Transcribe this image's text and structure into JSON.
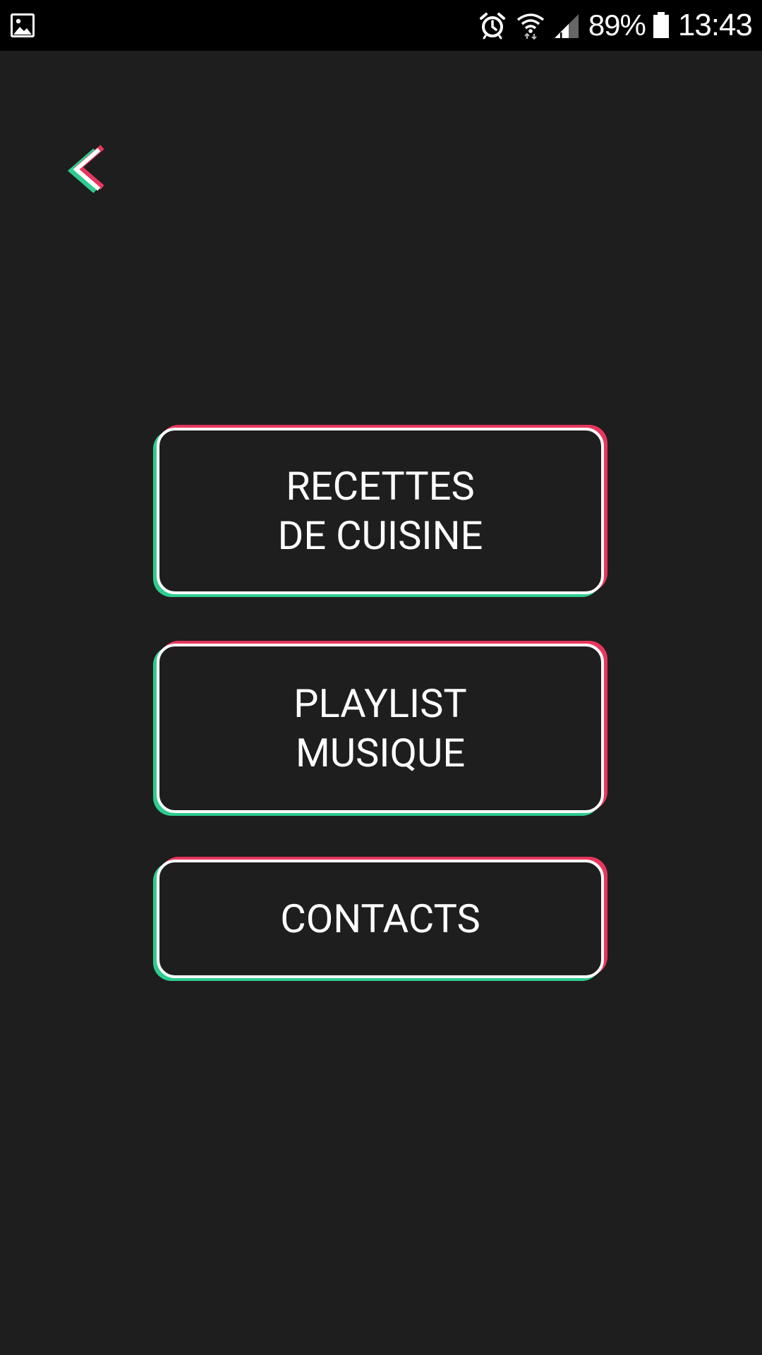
{
  "status_bar": {
    "left_icon": "gallery-icon",
    "alarm_icon": "alarm-icon",
    "wifi_icon": "wifi-icon",
    "signal_icon": "signal-icon",
    "battery_percent": "89%",
    "battery_icon": "battery-icon",
    "time": "13:43"
  },
  "nav": {
    "back_icon": "chevron-left-icon"
  },
  "menu": {
    "recettes": {
      "line1": "RECETTES",
      "line2": "DE CUISINE"
    },
    "playlist": {
      "line1": "PLAYLIST",
      "line2": "MUSIQUE"
    },
    "contacts": {
      "line1": "CONTACTS"
    }
  },
  "colors": {
    "background": "#1e1e1e",
    "accent_red": "#e8365d",
    "accent_green": "#2ecc8f",
    "button_border": "#ffffff"
  }
}
